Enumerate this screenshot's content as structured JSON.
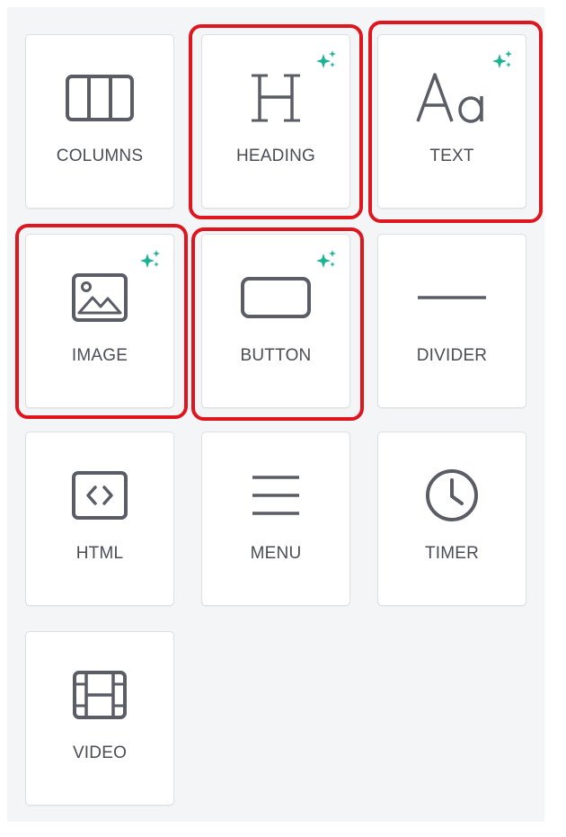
{
  "colors": {
    "highlight": "#e0161e",
    "ai_sparkle": "#1bb394",
    "icon": "#5a5d65"
  },
  "tools": [
    {
      "label": "COLUMNS",
      "icon": "columns-icon",
      "ai": false,
      "highlighted": false
    },
    {
      "label": "HEADING",
      "icon": "heading-icon",
      "ai": true,
      "highlighted": true
    },
    {
      "label": "TEXT",
      "icon": "text-icon",
      "ai": true,
      "highlighted": true
    },
    {
      "label": "IMAGE",
      "icon": "image-icon",
      "ai": true,
      "highlighted": true
    },
    {
      "label": "BUTTON",
      "icon": "button-icon",
      "ai": true,
      "highlighted": true
    },
    {
      "label": "DIVIDER",
      "icon": "divider-icon",
      "ai": false,
      "highlighted": false
    },
    {
      "label": "HTML",
      "icon": "html-icon",
      "ai": false,
      "highlighted": false
    },
    {
      "label": "MENU",
      "icon": "menu-icon",
      "ai": false,
      "highlighted": false
    },
    {
      "label": "TIMER",
      "icon": "clock-icon",
      "ai": false,
      "highlighted": false
    },
    {
      "label": "VIDEO",
      "icon": "video-icon",
      "ai": false,
      "highlighted": false
    }
  ]
}
